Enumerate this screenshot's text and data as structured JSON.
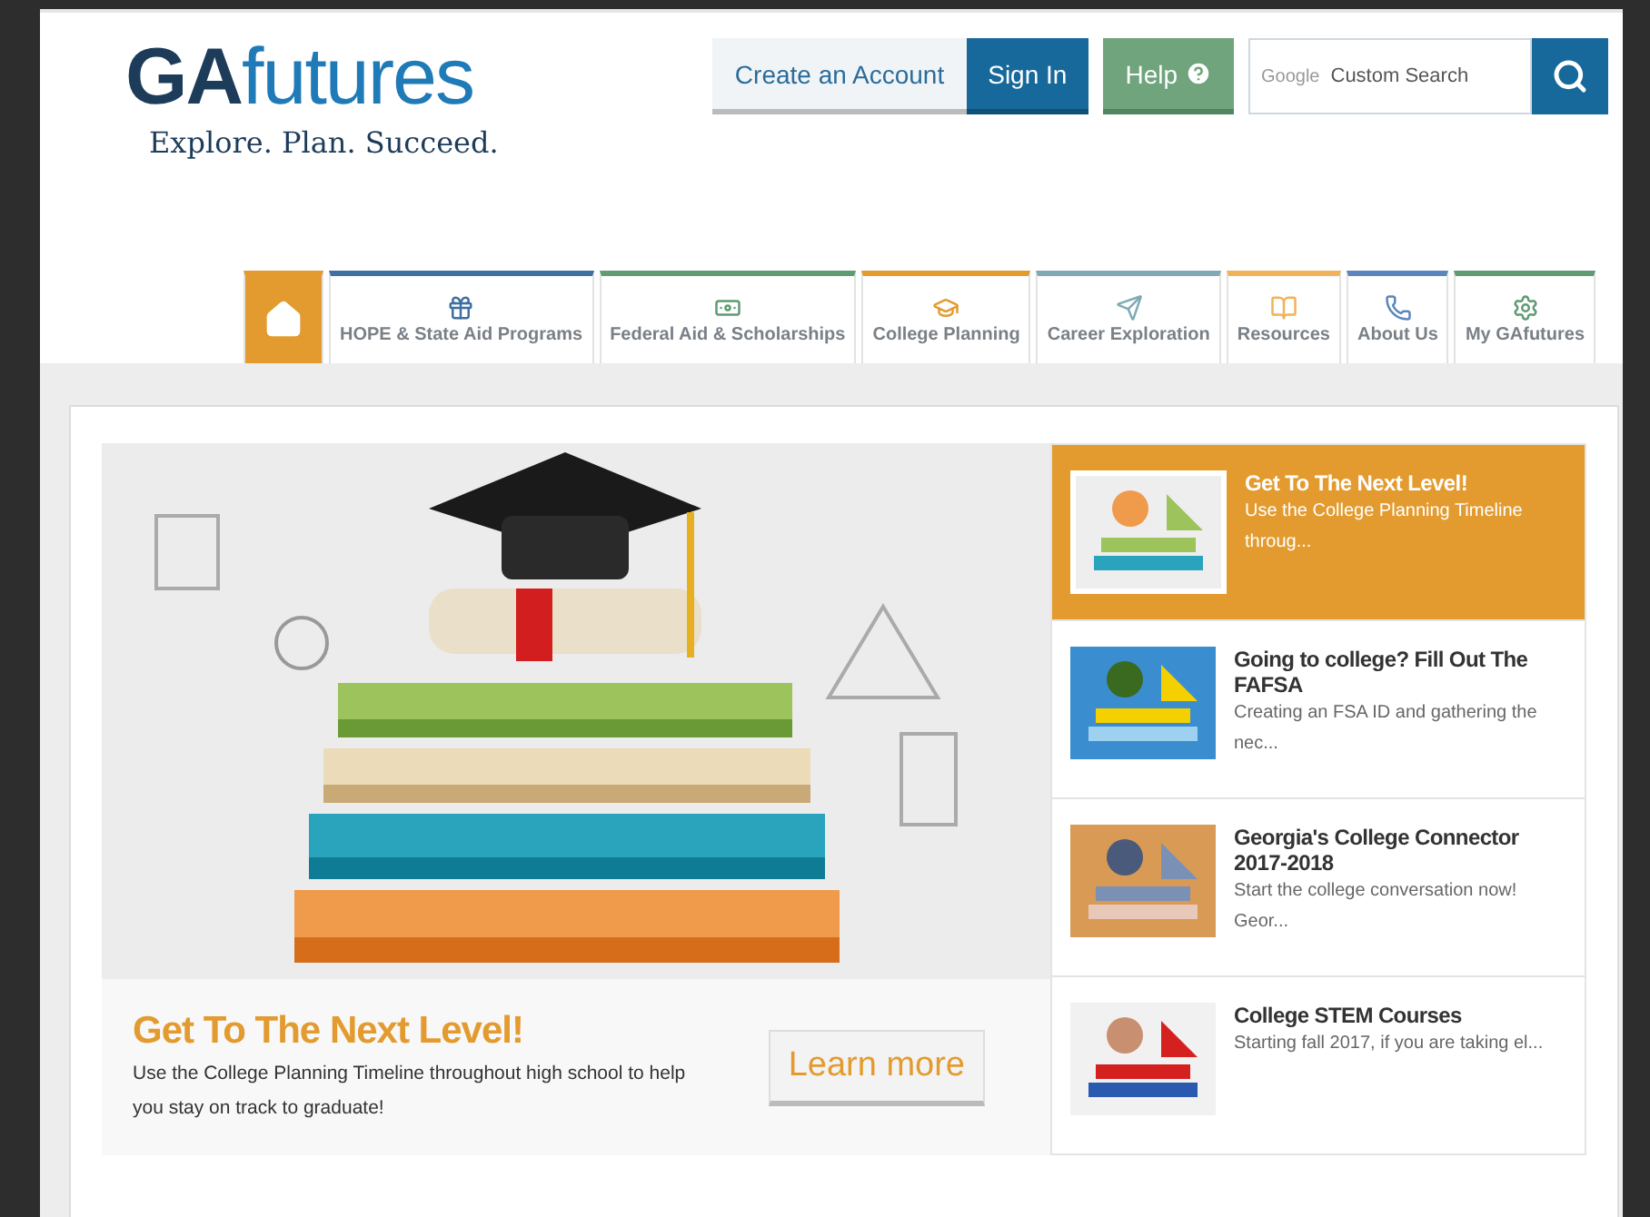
{
  "logo": {
    "brand_bold": "GA",
    "brand_light": "futures",
    "tagline": "Explore. Plan. Succeed."
  },
  "header_buttons": [
    {
      "label": "Create an Account",
      "kind": "light"
    },
    {
      "label": "Sign In",
      "kind": "primary"
    },
    {
      "label": "Help",
      "kind": "help"
    }
  ],
  "search": {
    "brand": "Google",
    "placeholder": "Custom Search"
  },
  "nav": [
    {
      "kind": "home",
      "selected": true,
      "color": "#e39b2f"
    },
    {
      "kind": "link",
      "label": "HOPE & State Aid Programs",
      "selected": false,
      "color": "#3f6fa3"
    },
    {
      "kind": "link",
      "label": "Federal Aid & Scholarships",
      "selected": false,
      "color": "#5f9b73"
    },
    {
      "kind": "link",
      "label": "College Planning",
      "selected": false,
      "color": "#e39b2f"
    },
    {
      "kind": "link",
      "label": "Career Exploration",
      "selected": false,
      "color": "#7faab5"
    },
    {
      "kind": "link",
      "label": "Resources",
      "selected": false,
      "color": "#f0b35a"
    },
    {
      "kind": "link",
      "label": "About Us",
      "selected": false,
      "color": "#5b86bd"
    },
    {
      "kind": "link",
      "label": "My GAfutures",
      "selected": false,
      "color": "#5f9b73"
    }
  ],
  "feature": {
    "title": "Get To The Next Level!",
    "text": "Use the College Planning Timeline throughout high school to help you stay on track to graduate!",
    "button": "Learn more"
  },
  "stories": [
    {
      "title": "Get To The Next Level!",
      "excerpt": "Use the College Planning Timeline throug...",
      "selected": true
    },
    {
      "title": "Going to college? Fill Out The FAFSA",
      "excerpt": "Creating an FSA ID and gathering the nec...",
      "selected": false
    },
    {
      "title": "Georgia's College Connector 2017-2018",
      "excerpt": "Start the college conversation now! Geor...",
      "selected": false
    },
    {
      "title": "College STEM Courses",
      "excerpt": "Starting fall 2017, if you are taking el...",
      "selected": false
    }
  ]
}
